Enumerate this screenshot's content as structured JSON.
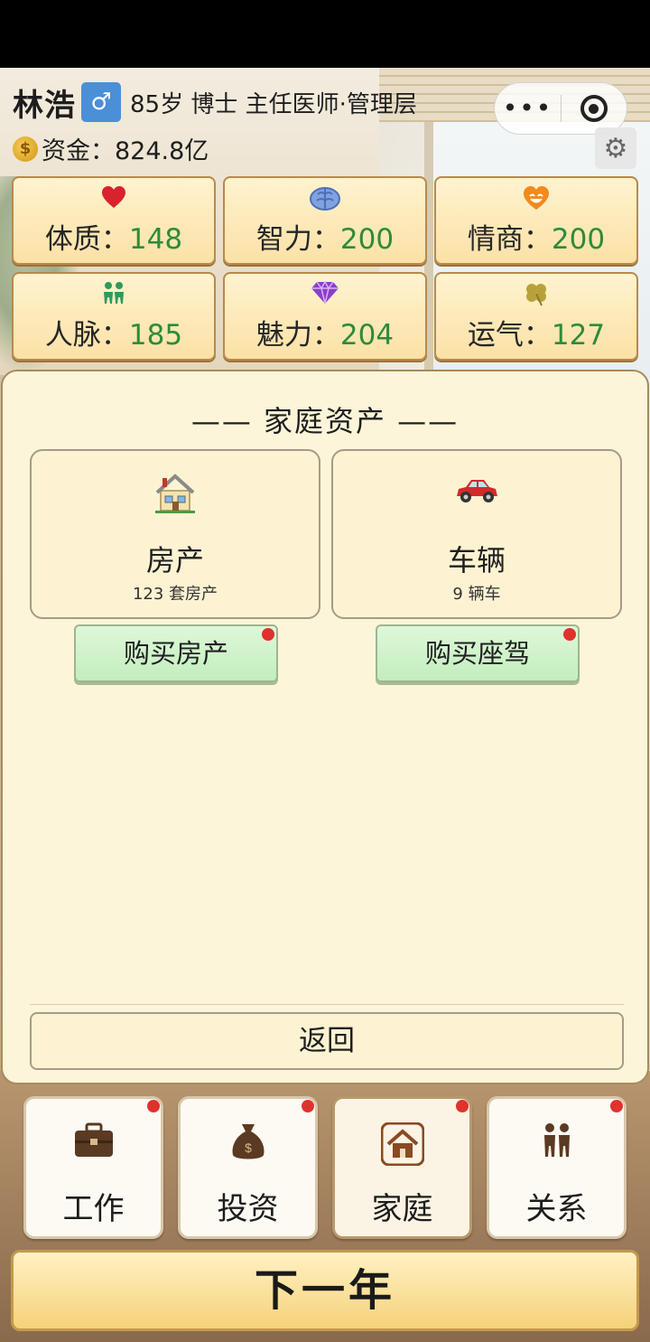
{
  "player": {
    "name": "林浩",
    "gender_symbol": "♂",
    "info": "85岁 博士 主任医师·管理层",
    "funds_label": "资金：",
    "funds_value": "824.8亿"
  },
  "stats": [
    {
      "icon": "heart-icon",
      "label": "体质：",
      "value": "148"
    },
    {
      "icon": "brain-icon",
      "label": "智力：",
      "value": "200"
    },
    {
      "icon": "smile-icon",
      "label": "情商：",
      "value": "200"
    },
    {
      "icon": "people-icon",
      "label": "人脉：",
      "value": "185"
    },
    {
      "icon": "diamond-icon",
      "label": "魅力：",
      "value": "204"
    },
    {
      "icon": "clover-icon",
      "label": "运气：",
      "value": "127"
    }
  ],
  "panel": {
    "title": "—— 家庭资产 ——",
    "property": {
      "title": "房产",
      "subtitle": "123 套房产",
      "button": "购买房产"
    },
    "vehicle": {
      "title": "车辆",
      "subtitle": "9 辆车",
      "button": "购买座驾"
    },
    "back": "返回"
  },
  "nav": [
    {
      "icon": "briefcase-icon",
      "label": "工作"
    },
    {
      "icon": "money-bag-icon",
      "label": "投资"
    },
    {
      "icon": "house-icon",
      "label": "家庭"
    },
    {
      "icon": "people-icon",
      "label": "关系"
    }
  ],
  "next_year": "下一年",
  "capsule": {
    "more": "•••"
  },
  "colors": {
    "stat_value": "#2e8b3a",
    "badge": "#e0322c",
    "gender_bg": "#4a8fd8"
  }
}
